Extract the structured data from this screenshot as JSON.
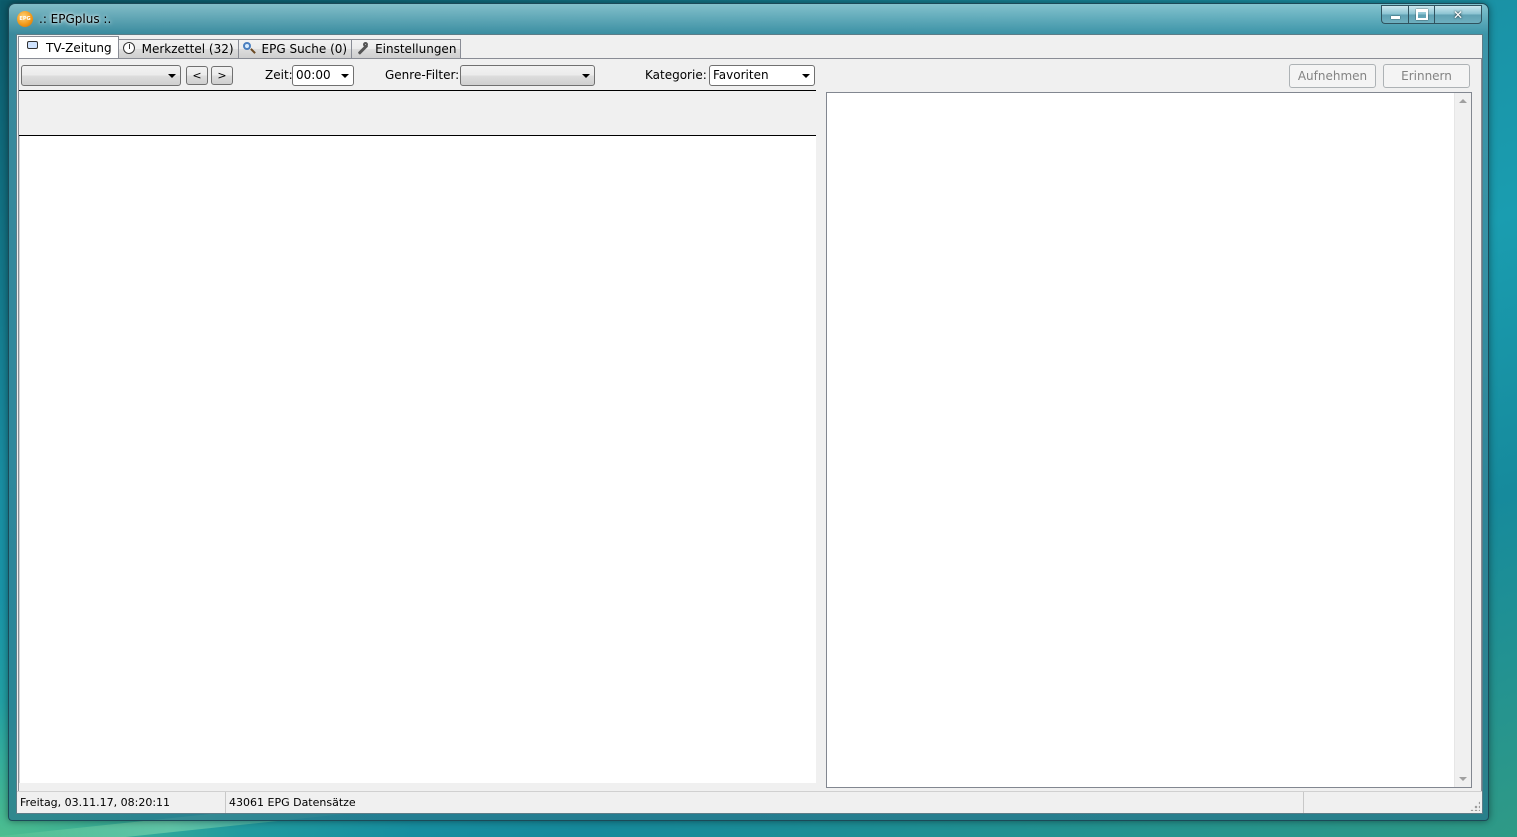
{
  "window": {
    "title": ".: EPGplus :.",
    "app_icon_text": "EPG"
  },
  "tabs": [
    {
      "label": "TV-Zeitung",
      "icon": "tv-icon",
      "active": true
    },
    {
      "label": "Merkzettel (32)",
      "icon": "clock-icon",
      "active": false
    },
    {
      "label": "EPG Suche (0)",
      "icon": "search-icon",
      "active": false
    },
    {
      "label": "Einstellungen",
      "icon": "tools-icon",
      "active": false
    }
  ],
  "toolbar": {
    "date_combo_value": "",
    "prev_label": "<",
    "next_label": ">",
    "time_label": "Zeit:",
    "time_value": "00:00",
    "genre_label": "Genre-Filter:",
    "genre_value": "",
    "category_label": "Kategorie:",
    "category_value": "Favoriten",
    "record_button": "Aufnehmen",
    "remind_button": "Erinnern"
  },
  "status": {
    "datetime": "Freitag, 03.11.17, 08:20:11",
    "records": "43061 EPG Datensätze",
    "extra": ""
  },
  "colors": {
    "window_frame": "#1b4a58",
    "client_bg": "#f0f0f0",
    "disabled_text": "#838383"
  }
}
